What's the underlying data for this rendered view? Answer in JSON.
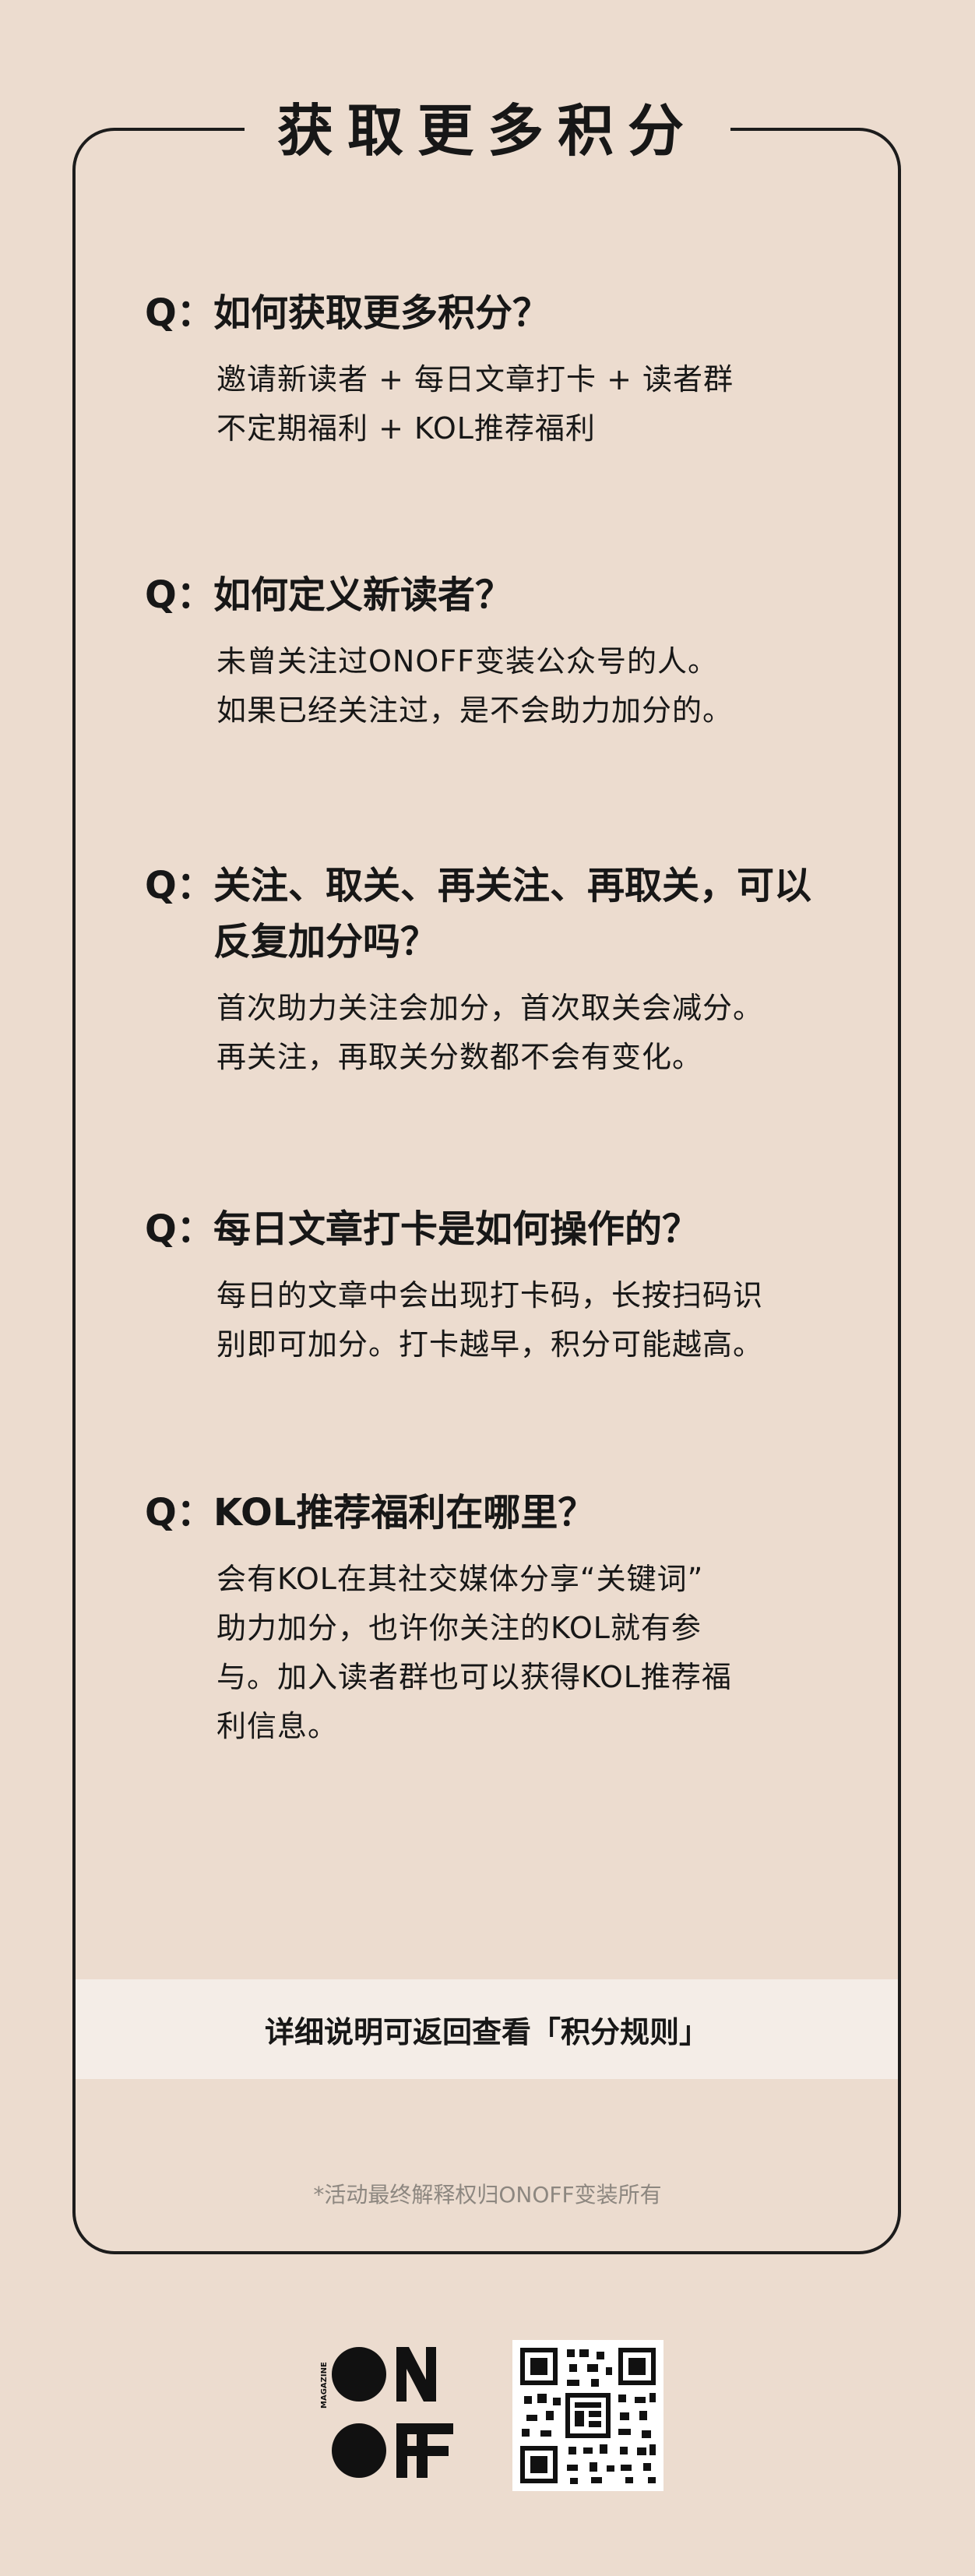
{
  "header": {
    "title": "获取更多积分"
  },
  "faq": [
    {
      "prefix": "Q：",
      "question": "如何获取更多积分？",
      "answer": [
        "邀请新读者 + 每日文章打卡 + 读者群",
        "不定期福利 + KOL推荐福利"
      ]
    },
    {
      "prefix": "Q：",
      "question": "如何定义新读者？",
      "answer": [
        "未曾关注过ONOFF变装公众号的人。",
        "如果已经关注过，是不会助力加分的。"
      ]
    },
    {
      "prefix": "Q：",
      "question": "关注、取关、再关注、再取关，可以反复加分吗？",
      "answer": [
        "首次助力关注会加分，首次取关会减分。",
        "再关注，再取关分数都不会有变化。"
      ]
    },
    {
      "prefix": "Q：",
      "question": "每日文章打卡是如何操作的？",
      "answer": [
        "每日的文章中会出现打卡码，长按扫码识",
        "别即可加分。打卡越早，积分可能越高。"
      ]
    },
    {
      "prefix": "Q：",
      "question": "KOL推荐福利在哪里？",
      "answer": [
        "会有KOL在其社交媒体分享“关键词”",
        "助力加分，也许你关注的KOL就有参",
        "与。加入读者群也可以获得KOL推荐福",
        "利信息。"
      ]
    }
  ],
  "rules_link": "详细说明可返回查看「积分规则」",
  "footnote": "*活动最终解释权归ONOFF变装所有",
  "footer": {
    "logo_text": "ONOFF",
    "logo_side_text": "MAGAZINE",
    "qr_icon": "qr-code-icon"
  },
  "colors": {
    "background": "#ecdccf",
    "text": "#171717",
    "border": "#1c1c1c",
    "rules_bar": "#f4ede7",
    "footnote": "#8d8780"
  }
}
